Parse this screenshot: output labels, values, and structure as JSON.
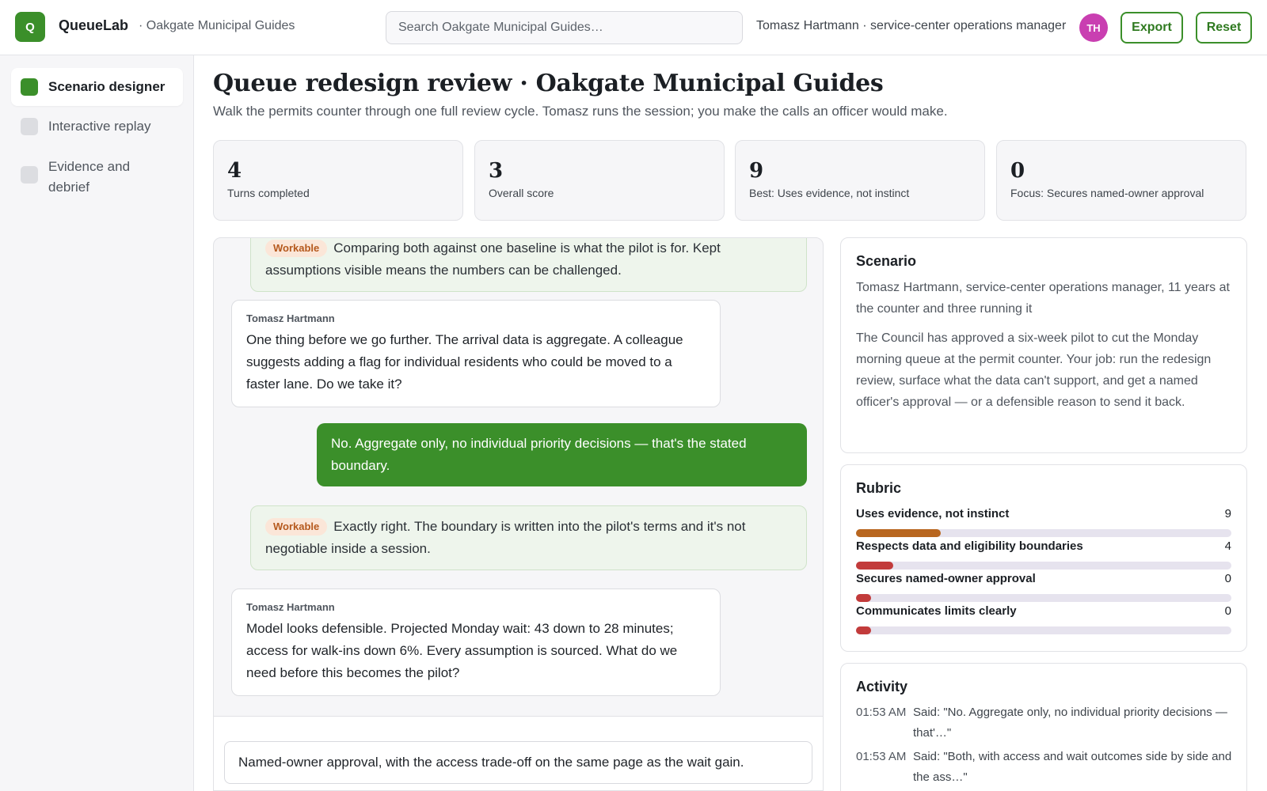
{
  "app": {
    "logo_letter": "Q",
    "name": "QueueLab",
    "breadcrumb": "· Oakgate Municipal Guides"
  },
  "search": {
    "placeholder": "Search Oakgate Municipal Guides…"
  },
  "user": {
    "line": "Tomasz Hartmann · service-center operations manager",
    "initials": "TH",
    "avatar_color": "#c93fb1"
  },
  "actions": {
    "export_label": "Export",
    "reset_label": "Reset"
  },
  "sidebar": {
    "items": [
      {
        "label": "Scenario designer",
        "active": true
      },
      {
        "label": "Interactive replay",
        "active": false
      },
      {
        "label": "Evidence and debrief",
        "active": false
      }
    ]
  },
  "page": {
    "title": "Queue redesign review · Oakgate Municipal Guides",
    "subtitle": "Walk the permits counter through one full review cycle. Tomasz runs the session; you make the calls an officer would make."
  },
  "stats": [
    {
      "value": "4",
      "label": "Turns completed"
    },
    {
      "value": "3",
      "label": "Overall score"
    },
    {
      "value": "9",
      "label": "Best: Uses evidence, not instinct"
    },
    {
      "value": "0",
      "label": "Focus: Secures named-owner approval"
    }
  ],
  "chat": {
    "messages": [
      {
        "type": "feedback",
        "tag": "Workable",
        "text": "Comparing both against one baseline is what the pilot is for. Kept assumptions visible means the numbers can be challenged."
      },
      {
        "type": "other",
        "sender": "Tomasz Hartmann",
        "text": "One thing before we go further. The arrival data is aggregate. A colleague suggests adding a flag for individual residents who could be moved to a faster lane. Do we take it?"
      },
      {
        "type": "me",
        "text": "No. Aggregate only, no individual priority decisions — that's the stated boundary."
      },
      {
        "type": "feedback",
        "tag": "Workable",
        "text": "Exactly right. The boundary is written into the pilot's terms and it's not negotiable inside a session."
      },
      {
        "type": "other",
        "sender": "Tomasz Hartmann",
        "text": "Model looks defensible. Projected Monday wait: 43 down to 28 minutes; access for walk-ins down 6%. Every assumption is sourced. What do we need before this becomes the pilot?"
      }
    ],
    "composer_value": "Named-owner approval, with the access trade-off on the same page as the wait gain."
  },
  "scenario": {
    "title": "Scenario",
    "persona": "Tomasz Hartmann, service-center operations manager, 11 years at the counter and three running it",
    "brief": "The Council has approved a six-week pilot to cut the Monday morning queue at the permit counter. Your job: run the redesign review, surface what the data can't support, and get a named officer's approval — or a defensible reason to send it back."
  },
  "rubric": {
    "title": "Rubric",
    "max": 40,
    "items": [
      {
        "name": "Uses evidence, not instinct",
        "score": 9,
        "color": "#b8661f"
      },
      {
        "name": "Respects data and eligibility boundaries",
        "score": 4,
        "color": "#c23b3b"
      },
      {
        "name": "Secures named-owner approval",
        "score": 0,
        "color": "#c23b3b"
      },
      {
        "name": "Communicates limits clearly",
        "score": 0,
        "color": "#c23b3b"
      }
    ]
  },
  "activity": {
    "title": "Activity",
    "items": [
      {
        "time": "01:53 AM",
        "text": "Said: \"No. Aggregate only, no individual priority decisions — that'…\""
      },
      {
        "time": "01:53 AM",
        "text": "Said: \"Both, with access and wait outcomes side by side and the ass…\""
      }
    ]
  },
  "colors": {
    "accent": "#3b8f2a",
    "feedback_bg": "#eef5ec",
    "tag_bg": "#fbe6d8",
    "tag_text": "#b5591d"
  }
}
